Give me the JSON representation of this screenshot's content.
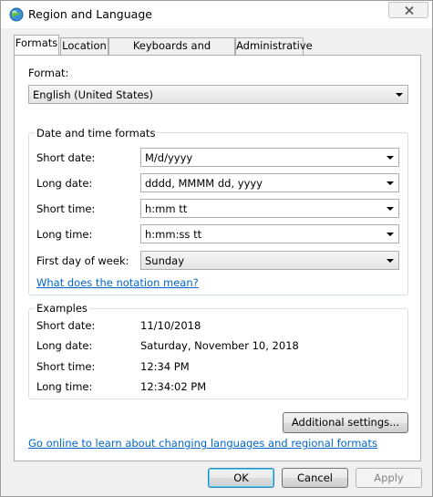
{
  "window": {
    "title": "Region and Language"
  },
  "tabs": [
    {
      "label": "Formats"
    },
    {
      "label": "Location"
    },
    {
      "label": "Keyboards and Languages"
    },
    {
      "label": "Administrative"
    }
  ],
  "format": {
    "label": "Format:",
    "value": "English (United States)"
  },
  "datetime": {
    "title": "Date and time formats",
    "short_date": {
      "label": "Short date:",
      "value": "M/d/yyyy"
    },
    "long_date": {
      "label": "Long date:",
      "value": "dddd, MMMM dd, yyyy"
    },
    "short_time": {
      "label": "Short time:",
      "value": "h:mm tt"
    },
    "long_time": {
      "label": "Long time:",
      "value": "h:mm:ss tt"
    },
    "first_day": {
      "label": "First day of week:",
      "value": "Sunday"
    },
    "notation_link": "What does the notation mean?"
  },
  "examples": {
    "title": "Examples",
    "short_date": {
      "label": "Short date:",
      "value": "11/10/2018"
    },
    "long_date": {
      "label": "Long date:",
      "value": "Saturday, November 10, 2018"
    },
    "short_time": {
      "label": "Short time:",
      "value": "12:34 PM"
    },
    "long_time": {
      "label": "Long time:",
      "value": "12:34:02 PM"
    }
  },
  "additional_settings": "Additional settings...",
  "online_link": "Go online to learn about changing languages and regional formats",
  "buttons": {
    "ok": "OK",
    "cancel": "Cancel",
    "apply": "Apply"
  }
}
